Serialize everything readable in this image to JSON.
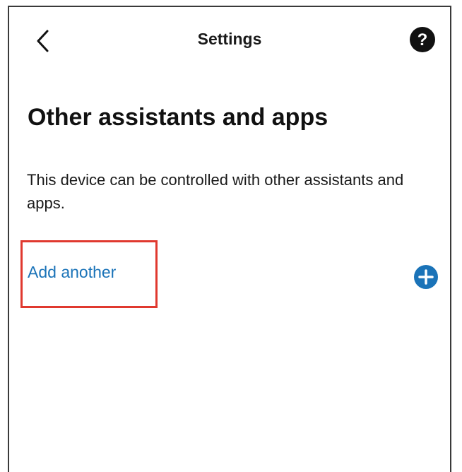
{
  "header": {
    "title": "Settings",
    "back_icon": "chevron-left-icon",
    "help_icon": "question-circle-icon"
  },
  "main": {
    "page_title": "Other assistants and apps",
    "description": "This device can be controlled with other assistants and apps.",
    "add_label": "Add another",
    "add_icon": "plus-circle-icon"
  },
  "colors": {
    "link": "#1a73b8",
    "plus_button": "#1a73b8",
    "highlight": "#e0392f",
    "text": "#111111"
  }
}
